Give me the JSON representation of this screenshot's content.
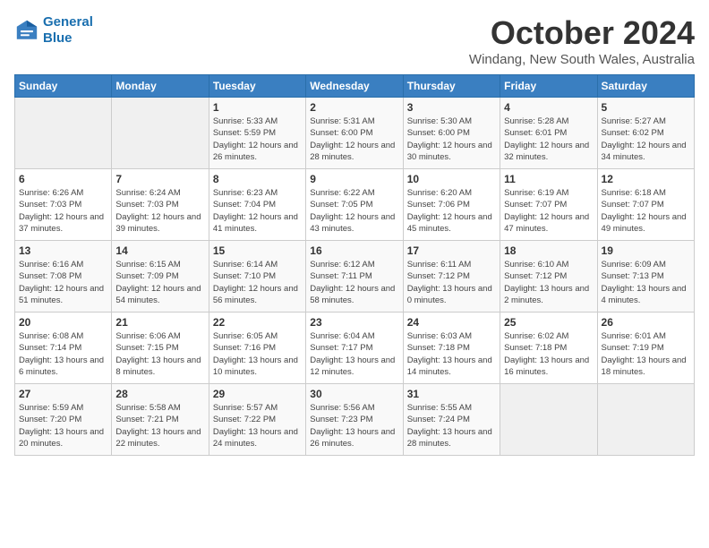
{
  "logo": {
    "line1": "General",
    "line2": "Blue"
  },
  "title": "October 2024",
  "subtitle": "Windang, New South Wales, Australia",
  "days_header": [
    "Sunday",
    "Monday",
    "Tuesday",
    "Wednesday",
    "Thursday",
    "Friday",
    "Saturday"
  ],
  "weeks": [
    [
      {
        "day": "",
        "sunrise": "",
        "sunset": "",
        "daylight": ""
      },
      {
        "day": "",
        "sunrise": "",
        "sunset": "",
        "daylight": ""
      },
      {
        "day": "1",
        "sunrise": "Sunrise: 5:33 AM",
        "sunset": "Sunset: 5:59 PM",
        "daylight": "Daylight: 12 hours and 26 minutes."
      },
      {
        "day": "2",
        "sunrise": "Sunrise: 5:31 AM",
        "sunset": "Sunset: 6:00 PM",
        "daylight": "Daylight: 12 hours and 28 minutes."
      },
      {
        "day": "3",
        "sunrise": "Sunrise: 5:30 AM",
        "sunset": "Sunset: 6:00 PM",
        "daylight": "Daylight: 12 hours and 30 minutes."
      },
      {
        "day": "4",
        "sunrise": "Sunrise: 5:28 AM",
        "sunset": "Sunset: 6:01 PM",
        "daylight": "Daylight: 12 hours and 32 minutes."
      },
      {
        "day": "5",
        "sunrise": "Sunrise: 5:27 AM",
        "sunset": "Sunset: 6:02 PM",
        "daylight": "Daylight: 12 hours and 34 minutes."
      }
    ],
    [
      {
        "day": "6",
        "sunrise": "Sunrise: 6:26 AM",
        "sunset": "Sunset: 7:03 PM",
        "daylight": "Daylight: 12 hours and 37 minutes."
      },
      {
        "day": "7",
        "sunrise": "Sunrise: 6:24 AM",
        "sunset": "Sunset: 7:03 PM",
        "daylight": "Daylight: 12 hours and 39 minutes."
      },
      {
        "day": "8",
        "sunrise": "Sunrise: 6:23 AM",
        "sunset": "Sunset: 7:04 PM",
        "daylight": "Daylight: 12 hours and 41 minutes."
      },
      {
        "day": "9",
        "sunrise": "Sunrise: 6:22 AM",
        "sunset": "Sunset: 7:05 PM",
        "daylight": "Daylight: 12 hours and 43 minutes."
      },
      {
        "day": "10",
        "sunrise": "Sunrise: 6:20 AM",
        "sunset": "Sunset: 7:06 PM",
        "daylight": "Daylight: 12 hours and 45 minutes."
      },
      {
        "day": "11",
        "sunrise": "Sunrise: 6:19 AM",
        "sunset": "Sunset: 7:07 PM",
        "daylight": "Daylight: 12 hours and 47 minutes."
      },
      {
        "day": "12",
        "sunrise": "Sunrise: 6:18 AM",
        "sunset": "Sunset: 7:07 PM",
        "daylight": "Daylight: 12 hours and 49 minutes."
      }
    ],
    [
      {
        "day": "13",
        "sunrise": "Sunrise: 6:16 AM",
        "sunset": "Sunset: 7:08 PM",
        "daylight": "Daylight: 12 hours and 51 minutes."
      },
      {
        "day": "14",
        "sunrise": "Sunrise: 6:15 AM",
        "sunset": "Sunset: 7:09 PM",
        "daylight": "Daylight: 12 hours and 54 minutes."
      },
      {
        "day": "15",
        "sunrise": "Sunrise: 6:14 AM",
        "sunset": "Sunset: 7:10 PM",
        "daylight": "Daylight: 12 hours and 56 minutes."
      },
      {
        "day": "16",
        "sunrise": "Sunrise: 6:12 AM",
        "sunset": "Sunset: 7:11 PM",
        "daylight": "Daylight: 12 hours and 58 minutes."
      },
      {
        "day": "17",
        "sunrise": "Sunrise: 6:11 AM",
        "sunset": "Sunset: 7:12 PM",
        "daylight": "Daylight: 13 hours and 0 minutes."
      },
      {
        "day": "18",
        "sunrise": "Sunrise: 6:10 AM",
        "sunset": "Sunset: 7:12 PM",
        "daylight": "Daylight: 13 hours and 2 minutes."
      },
      {
        "day": "19",
        "sunrise": "Sunrise: 6:09 AM",
        "sunset": "Sunset: 7:13 PM",
        "daylight": "Daylight: 13 hours and 4 minutes."
      }
    ],
    [
      {
        "day": "20",
        "sunrise": "Sunrise: 6:08 AM",
        "sunset": "Sunset: 7:14 PM",
        "daylight": "Daylight: 13 hours and 6 minutes."
      },
      {
        "day": "21",
        "sunrise": "Sunrise: 6:06 AM",
        "sunset": "Sunset: 7:15 PM",
        "daylight": "Daylight: 13 hours and 8 minutes."
      },
      {
        "day": "22",
        "sunrise": "Sunrise: 6:05 AM",
        "sunset": "Sunset: 7:16 PM",
        "daylight": "Daylight: 13 hours and 10 minutes."
      },
      {
        "day": "23",
        "sunrise": "Sunrise: 6:04 AM",
        "sunset": "Sunset: 7:17 PM",
        "daylight": "Daylight: 13 hours and 12 minutes."
      },
      {
        "day": "24",
        "sunrise": "Sunrise: 6:03 AM",
        "sunset": "Sunset: 7:18 PM",
        "daylight": "Daylight: 13 hours and 14 minutes."
      },
      {
        "day": "25",
        "sunrise": "Sunrise: 6:02 AM",
        "sunset": "Sunset: 7:18 PM",
        "daylight": "Daylight: 13 hours and 16 minutes."
      },
      {
        "day": "26",
        "sunrise": "Sunrise: 6:01 AM",
        "sunset": "Sunset: 7:19 PM",
        "daylight": "Daylight: 13 hours and 18 minutes."
      }
    ],
    [
      {
        "day": "27",
        "sunrise": "Sunrise: 5:59 AM",
        "sunset": "Sunset: 7:20 PM",
        "daylight": "Daylight: 13 hours and 20 minutes."
      },
      {
        "day": "28",
        "sunrise": "Sunrise: 5:58 AM",
        "sunset": "Sunset: 7:21 PM",
        "daylight": "Daylight: 13 hours and 22 minutes."
      },
      {
        "day": "29",
        "sunrise": "Sunrise: 5:57 AM",
        "sunset": "Sunset: 7:22 PM",
        "daylight": "Daylight: 13 hours and 24 minutes."
      },
      {
        "day": "30",
        "sunrise": "Sunrise: 5:56 AM",
        "sunset": "Sunset: 7:23 PM",
        "daylight": "Daylight: 13 hours and 26 minutes."
      },
      {
        "day": "31",
        "sunrise": "Sunrise: 5:55 AM",
        "sunset": "Sunset: 7:24 PM",
        "daylight": "Daylight: 13 hours and 28 minutes."
      },
      {
        "day": "",
        "sunrise": "",
        "sunset": "",
        "daylight": ""
      },
      {
        "day": "",
        "sunrise": "",
        "sunset": "",
        "daylight": ""
      }
    ]
  ]
}
